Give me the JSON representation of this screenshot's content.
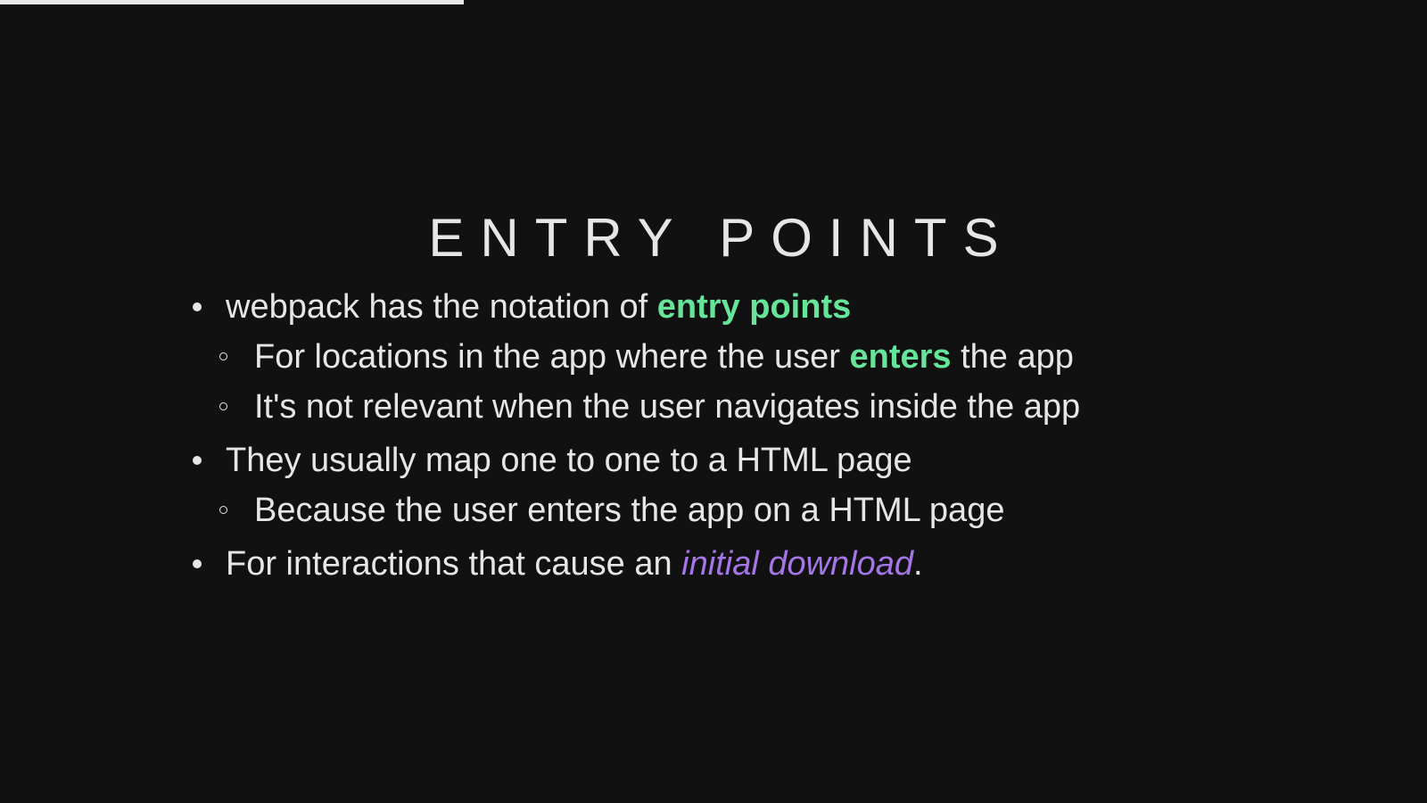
{
  "progress": {
    "fraction": 0.325,
    "color": "#e6e6e6"
  },
  "slide": {
    "title": "ENTRY POINTS",
    "bullets": [
      {
        "text_before": "webpack has the notation of ",
        "highlight": "entry points",
        "text_after": "",
        "subbullets": [
          {
            "text_before": "For locations in the app where the user ",
            "highlight": "enters",
            "text_after": " the app"
          },
          {
            "text": "It's not relevant when the user navigates inside the app"
          }
        ]
      },
      {
        "text": "They usually map one to one to a HTML page",
        "subbullets": [
          {
            "text": "Because the user enters the app on a HTML page"
          }
        ]
      },
      {
        "text_before": "For interactions that cause an ",
        "emphasis": "initial download",
        "text_after": "."
      }
    ]
  },
  "colors": {
    "background": "#111111",
    "text": "#e6e6e6",
    "accent_green": "#66e59a",
    "accent_purple": "#a476e8"
  }
}
